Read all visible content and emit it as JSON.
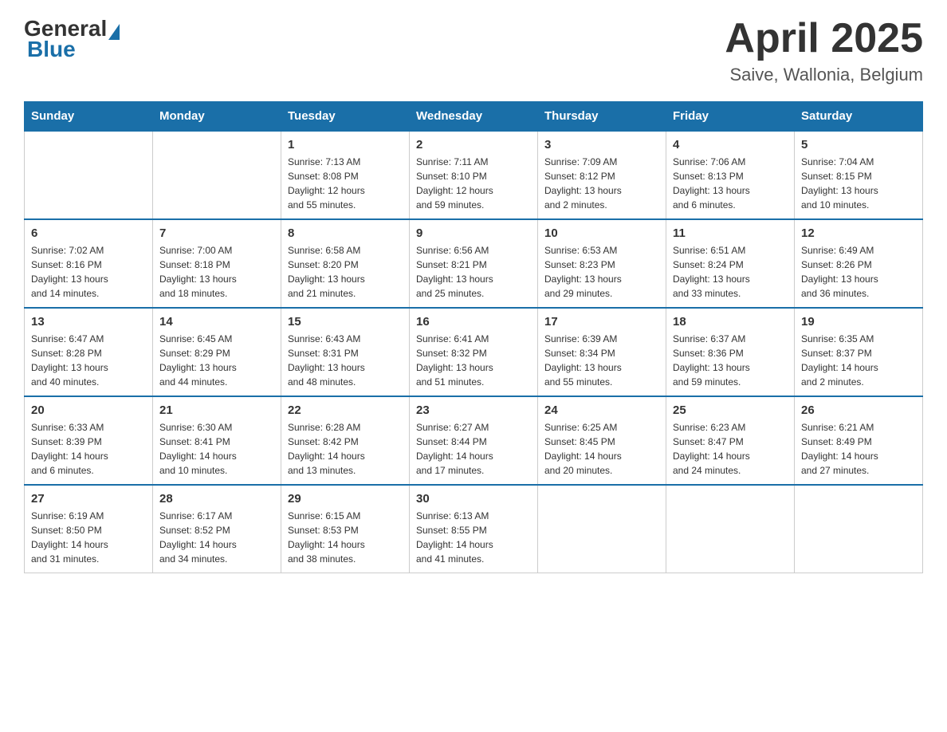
{
  "header": {
    "logo": {
      "general": "General",
      "blue": "Blue"
    },
    "title": "April 2025",
    "location": "Saive, Wallonia, Belgium"
  },
  "weekdays": [
    "Sunday",
    "Monday",
    "Tuesday",
    "Wednesday",
    "Thursday",
    "Friday",
    "Saturday"
  ],
  "weeks": [
    [
      {
        "day": "",
        "info": ""
      },
      {
        "day": "",
        "info": ""
      },
      {
        "day": "1",
        "info": "Sunrise: 7:13 AM\nSunset: 8:08 PM\nDaylight: 12 hours\nand 55 minutes."
      },
      {
        "day": "2",
        "info": "Sunrise: 7:11 AM\nSunset: 8:10 PM\nDaylight: 12 hours\nand 59 minutes."
      },
      {
        "day": "3",
        "info": "Sunrise: 7:09 AM\nSunset: 8:12 PM\nDaylight: 13 hours\nand 2 minutes."
      },
      {
        "day": "4",
        "info": "Sunrise: 7:06 AM\nSunset: 8:13 PM\nDaylight: 13 hours\nand 6 minutes."
      },
      {
        "day": "5",
        "info": "Sunrise: 7:04 AM\nSunset: 8:15 PM\nDaylight: 13 hours\nand 10 minutes."
      }
    ],
    [
      {
        "day": "6",
        "info": "Sunrise: 7:02 AM\nSunset: 8:16 PM\nDaylight: 13 hours\nand 14 minutes."
      },
      {
        "day": "7",
        "info": "Sunrise: 7:00 AM\nSunset: 8:18 PM\nDaylight: 13 hours\nand 18 minutes."
      },
      {
        "day": "8",
        "info": "Sunrise: 6:58 AM\nSunset: 8:20 PM\nDaylight: 13 hours\nand 21 minutes."
      },
      {
        "day": "9",
        "info": "Sunrise: 6:56 AM\nSunset: 8:21 PM\nDaylight: 13 hours\nand 25 minutes."
      },
      {
        "day": "10",
        "info": "Sunrise: 6:53 AM\nSunset: 8:23 PM\nDaylight: 13 hours\nand 29 minutes."
      },
      {
        "day": "11",
        "info": "Sunrise: 6:51 AM\nSunset: 8:24 PM\nDaylight: 13 hours\nand 33 minutes."
      },
      {
        "day": "12",
        "info": "Sunrise: 6:49 AM\nSunset: 8:26 PM\nDaylight: 13 hours\nand 36 minutes."
      }
    ],
    [
      {
        "day": "13",
        "info": "Sunrise: 6:47 AM\nSunset: 8:28 PM\nDaylight: 13 hours\nand 40 minutes."
      },
      {
        "day": "14",
        "info": "Sunrise: 6:45 AM\nSunset: 8:29 PM\nDaylight: 13 hours\nand 44 minutes."
      },
      {
        "day": "15",
        "info": "Sunrise: 6:43 AM\nSunset: 8:31 PM\nDaylight: 13 hours\nand 48 minutes."
      },
      {
        "day": "16",
        "info": "Sunrise: 6:41 AM\nSunset: 8:32 PM\nDaylight: 13 hours\nand 51 minutes."
      },
      {
        "day": "17",
        "info": "Sunrise: 6:39 AM\nSunset: 8:34 PM\nDaylight: 13 hours\nand 55 minutes."
      },
      {
        "day": "18",
        "info": "Sunrise: 6:37 AM\nSunset: 8:36 PM\nDaylight: 13 hours\nand 59 minutes."
      },
      {
        "day": "19",
        "info": "Sunrise: 6:35 AM\nSunset: 8:37 PM\nDaylight: 14 hours\nand 2 minutes."
      }
    ],
    [
      {
        "day": "20",
        "info": "Sunrise: 6:33 AM\nSunset: 8:39 PM\nDaylight: 14 hours\nand 6 minutes."
      },
      {
        "day": "21",
        "info": "Sunrise: 6:30 AM\nSunset: 8:41 PM\nDaylight: 14 hours\nand 10 minutes."
      },
      {
        "day": "22",
        "info": "Sunrise: 6:28 AM\nSunset: 8:42 PM\nDaylight: 14 hours\nand 13 minutes."
      },
      {
        "day": "23",
        "info": "Sunrise: 6:27 AM\nSunset: 8:44 PM\nDaylight: 14 hours\nand 17 minutes."
      },
      {
        "day": "24",
        "info": "Sunrise: 6:25 AM\nSunset: 8:45 PM\nDaylight: 14 hours\nand 20 minutes."
      },
      {
        "day": "25",
        "info": "Sunrise: 6:23 AM\nSunset: 8:47 PM\nDaylight: 14 hours\nand 24 minutes."
      },
      {
        "day": "26",
        "info": "Sunrise: 6:21 AM\nSunset: 8:49 PM\nDaylight: 14 hours\nand 27 minutes."
      }
    ],
    [
      {
        "day": "27",
        "info": "Sunrise: 6:19 AM\nSunset: 8:50 PM\nDaylight: 14 hours\nand 31 minutes."
      },
      {
        "day": "28",
        "info": "Sunrise: 6:17 AM\nSunset: 8:52 PM\nDaylight: 14 hours\nand 34 minutes."
      },
      {
        "day": "29",
        "info": "Sunrise: 6:15 AM\nSunset: 8:53 PM\nDaylight: 14 hours\nand 38 minutes."
      },
      {
        "day": "30",
        "info": "Sunrise: 6:13 AM\nSunset: 8:55 PM\nDaylight: 14 hours\nand 41 minutes."
      },
      {
        "day": "",
        "info": ""
      },
      {
        "day": "",
        "info": ""
      },
      {
        "day": "",
        "info": ""
      }
    ]
  ]
}
